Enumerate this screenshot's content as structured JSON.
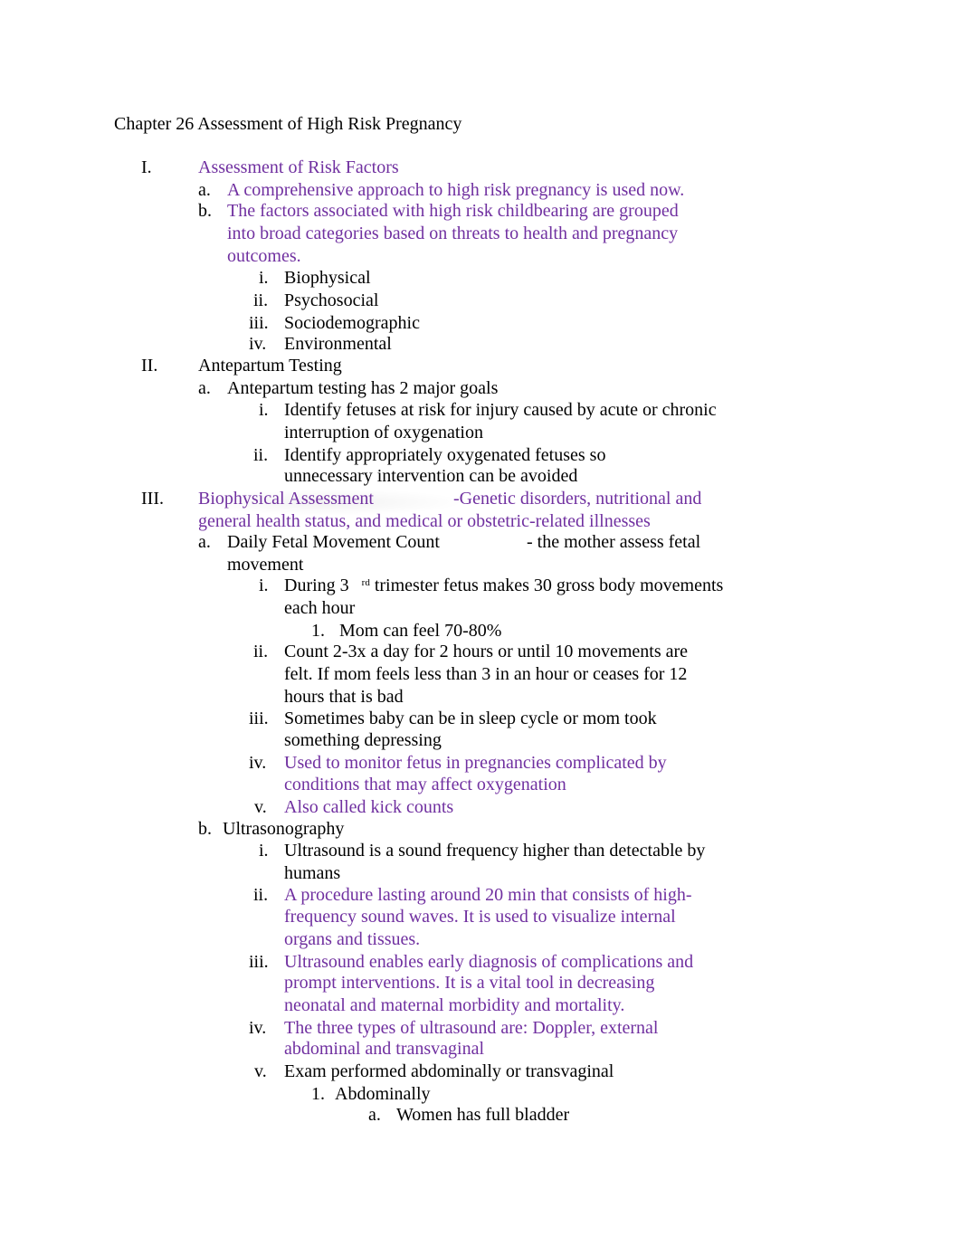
{
  "title": "Chapter 26 Assessment of High Risk Pregnancy",
  "colors": {
    "highlight": "#7030A0",
    "text": "#000000"
  },
  "sections": {
    "s1": {
      "num": "I.",
      "heading": "Assessment of Risk Factors",
      "a": {
        "num": "a.",
        "text": "A comprehensive approach to high risk pregnancy is used now."
      },
      "b": {
        "num": "b.",
        "lines": [
          "The factors associated with high risk childbearing are grouped",
          "into broad categories based on threats to health and pregnancy",
          "outcomes."
        ],
        "items": [
          {
            "num": "i.",
            "text": "Biophysical"
          },
          {
            "num": "ii.",
            "text": "Psychosocial"
          },
          {
            "num": "iii.",
            "text": "Sociodemographic"
          },
          {
            "num": "iv.",
            "text": "Environmental"
          }
        ]
      }
    },
    "s2": {
      "num": "II.",
      "heading": "Antepartum Testing",
      "a": {
        "num": "a.",
        "text": "Antepartum testing has 2 major goals",
        "items": [
          {
            "num": "i.",
            "lines": [
              "Identify fetuses at risk for injury caused by acute or chronic",
              "interruption of oxygenation"
            ]
          },
          {
            "num": "ii.",
            "lines": [
              "Identify appropriately oxygenated fetuses so",
              "unnecessary intervention can be avoided"
            ]
          }
        ]
      }
    },
    "s3": {
      "num": "III.",
      "heading": "Biophysical Assessment",
      "heading_note": "-Genetic disorders, nutritional and",
      "heading_line2": "general health status, and medical or obstetric-related illnesses",
      "a": {
        "num": "a.",
        "text": "Daily Fetal Movement Count",
        "note": "- the mother assess fetal",
        "line2": "movement",
        "items": [
          {
            "num": "i.",
            "pre": "During 3",
            "sup": "rd",
            "post": "trimester fetus makes 30 gross body movements",
            "line2": "each hour",
            "sub": {
              "num": "1.",
              "text": "Mom can feel 70-80%"
            }
          },
          {
            "num": "ii.",
            "lines": [
              "Count 2-3x a day for 2 hours or until 10 movements are",
              "felt. If mom feels less than 3 in an hour or ceases for 12",
              "hours that is bad"
            ]
          },
          {
            "num": "iii.",
            "lines": [
              "Sometimes baby can be in sleep cycle or mom took",
              "something depressing"
            ]
          },
          {
            "num": "iv.",
            "lines": [
              "Used to monitor fetus in pregnancies complicated by",
              "conditions that may affect oxygenation"
            ]
          },
          {
            "num": "v.",
            "lines": [
              "Also called kick counts"
            ]
          }
        ]
      },
      "b": {
        "num": "b.",
        "text": "Ultrasonography",
        "items": [
          {
            "num": "i.",
            "lines": [
              "Ultrasound is a sound frequency higher than detectable by",
              "humans"
            ]
          },
          {
            "num": "ii.",
            "lines": [
              "A procedure lasting around 20 min that consists of high-",
              "frequency sound waves. It is used to visualize internal",
              "organs and tissues."
            ]
          },
          {
            "num": "iii.",
            "lines": [
              "Ultrasound enables early diagnosis of complications and",
              "prompt interventions. It is a vital tool in decreasing",
              "neonatal and maternal morbidity and mortality."
            ]
          },
          {
            "num": "iv.",
            "lines": [
              "The three types of ultrasound are: Doppler, external",
              "abdominal and transvaginal"
            ]
          },
          {
            "num": "v.",
            "lines": [
              "Exam performed abdominally or transvaginal"
            ],
            "sub": {
              "num": "1.",
              "text": "Abdominally",
              "sub": {
                "num": "a.",
                "text": "Women has full bladder"
              }
            }
          }
        ]
      }
    }
  }
}
